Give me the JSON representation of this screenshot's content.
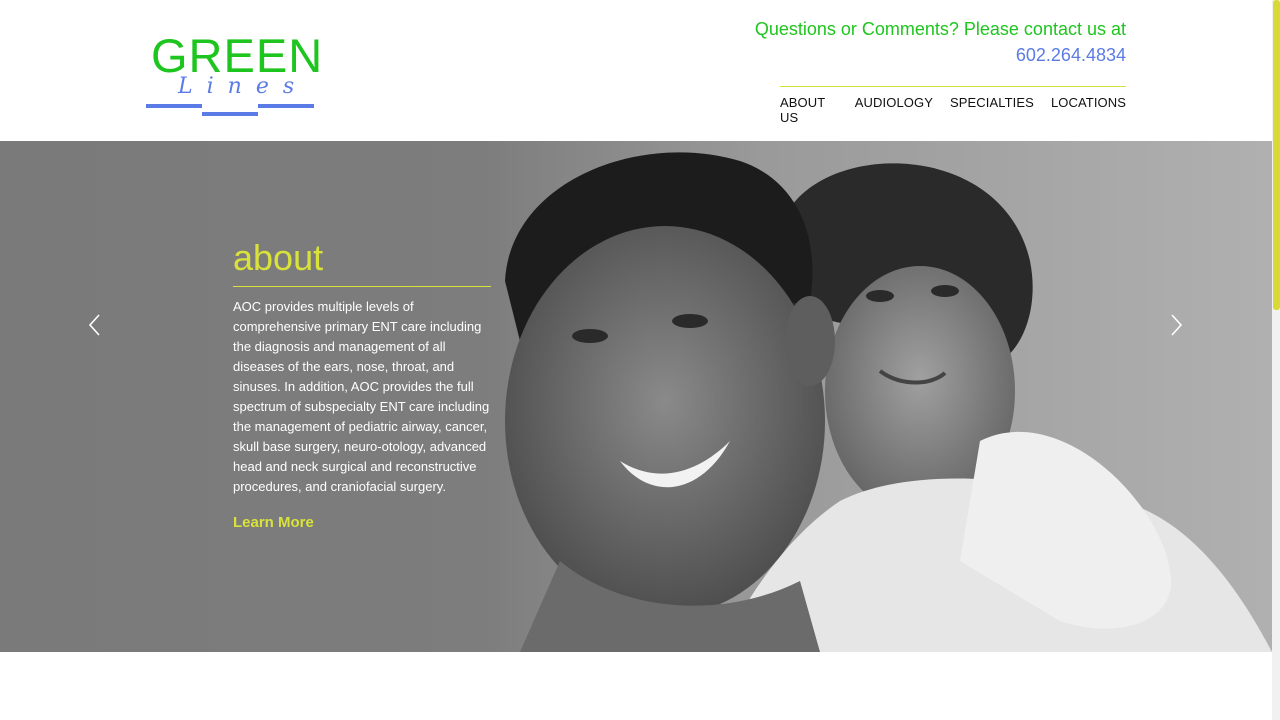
{
  "brand": {
    "name": "GREEN",
    "script": "Lines",
    "colors": {
      "green": "#1ec51e",
      "blue": "#5b7be6",
      "accent": "#d9e23a"
    }
  },
  "contact": {
    "line": "Questions or Comments? Please contact us at",
    "phone": "602.264.4834"
  },
  "nav": {
    "items": [
      {
        "label": "ABOUT US"
      },
      {
        "label": "AUDIOLOGY"
      },
      {
        "label": "SPECIALTIES"
      },
      {
        "label": "LOCATIONS"
      }
    ]
  },
  "hero": {
    "title": "about",
    "text": "AOC provides multiple levels of comprehensive primary ENT care including the diagnosis and management of all diseases of the ears, nose, throat, and sinuses. In addition, AOC provides the full spectrum of subspecialty ENT care including the management of pediatric airway, cancer, skull base surgery, neuro-otology, advanced head and neck surgical and reconstructive procedures, and craniofacial surgery.",
    "cta": "Learn More",
    "prev_icon": "chevron-left-icon",
    "next_icon": "chevron-right-icon"
  }
}
